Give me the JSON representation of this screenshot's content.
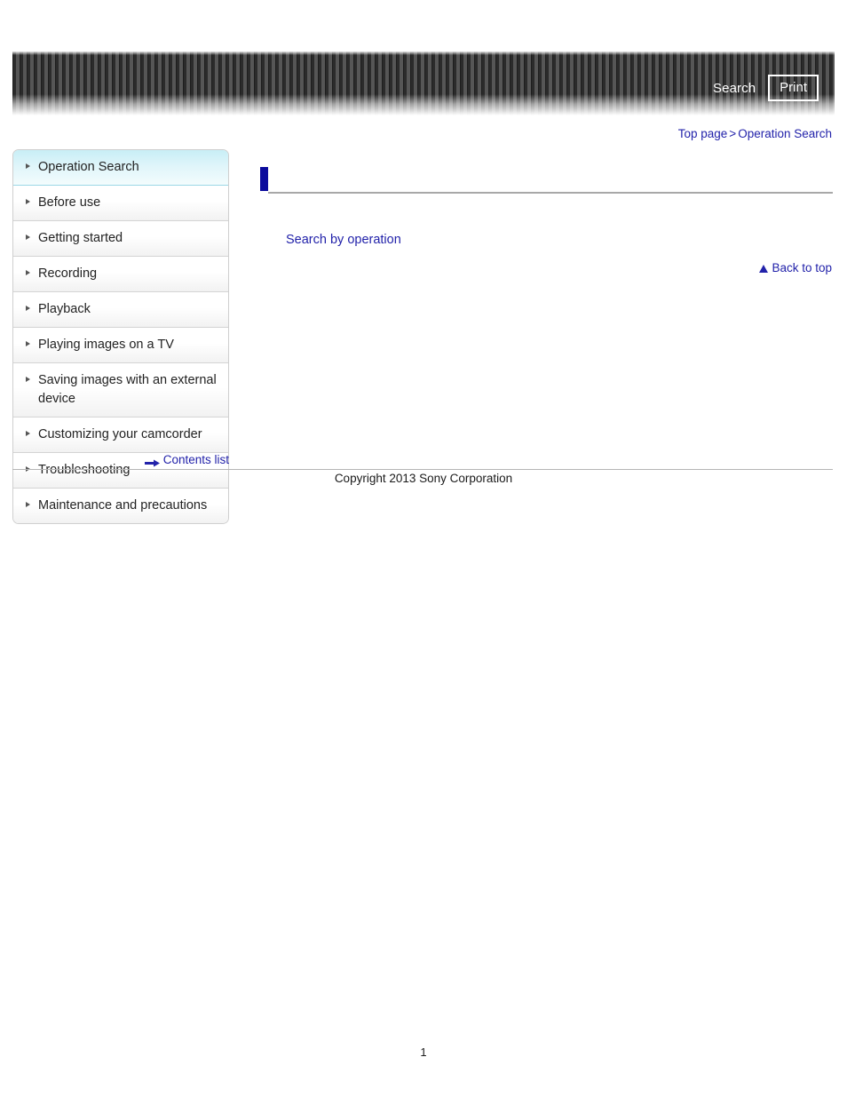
{
  "header": {
    "search_label": "Search",
    "print_label": "Print",
    "search_icon": "search-icon",
    "print_icon": "print-icon"
  },
  "breadcrumb": {
    "top_label": "Top page",
    "separator": ">",
    "current_label": "Operation Search"
  },
  "sidebar": {
    "items": [
      {
        "label": "Operation Search",
        "active": true
      },
      {
        "label": "Before use",
        "active": false
      },
      {
        "label": "Getting started",
        "active": false
      },
      {
        "label": "Recording",
        "active": false
      },
      {
        "label": "Playback",
        "active": false
      },
      {
        "label": "Playing images on a TV",
        "active": false
      },
      {
        "label": "Saving images with an external device",
        "active": false
      },
      {
        "label": "Customizing your camcorder",
        "active": false
      },
      {
        "label": "Troubleshooting",
        "active": false
      },
      {
        "label": "Maintenance and precautions",
        "active": false
      }
    ],
    "contents_list_label": "Contents list",
    "contents_list_icon": "arrow-right-icon"
  },
  "main": {
    "heading": "",
    "heading_marker_color": "#0b0b9c",
    "search_by_operation_label": "Search by operation",
    "back_to_top_label": "Back to top",
    "back_to_top_icon": "triangle-up-icon"
  },
  "footer": {
    "copyright": "Copyright 2013 Sony Corporation",
    "page_number": "1"
  },
  "colors": {
    "link": "#2222aa",
    "accent": "#0b0b9c",
    "active_nav": "#c8eef6"
  }
}
